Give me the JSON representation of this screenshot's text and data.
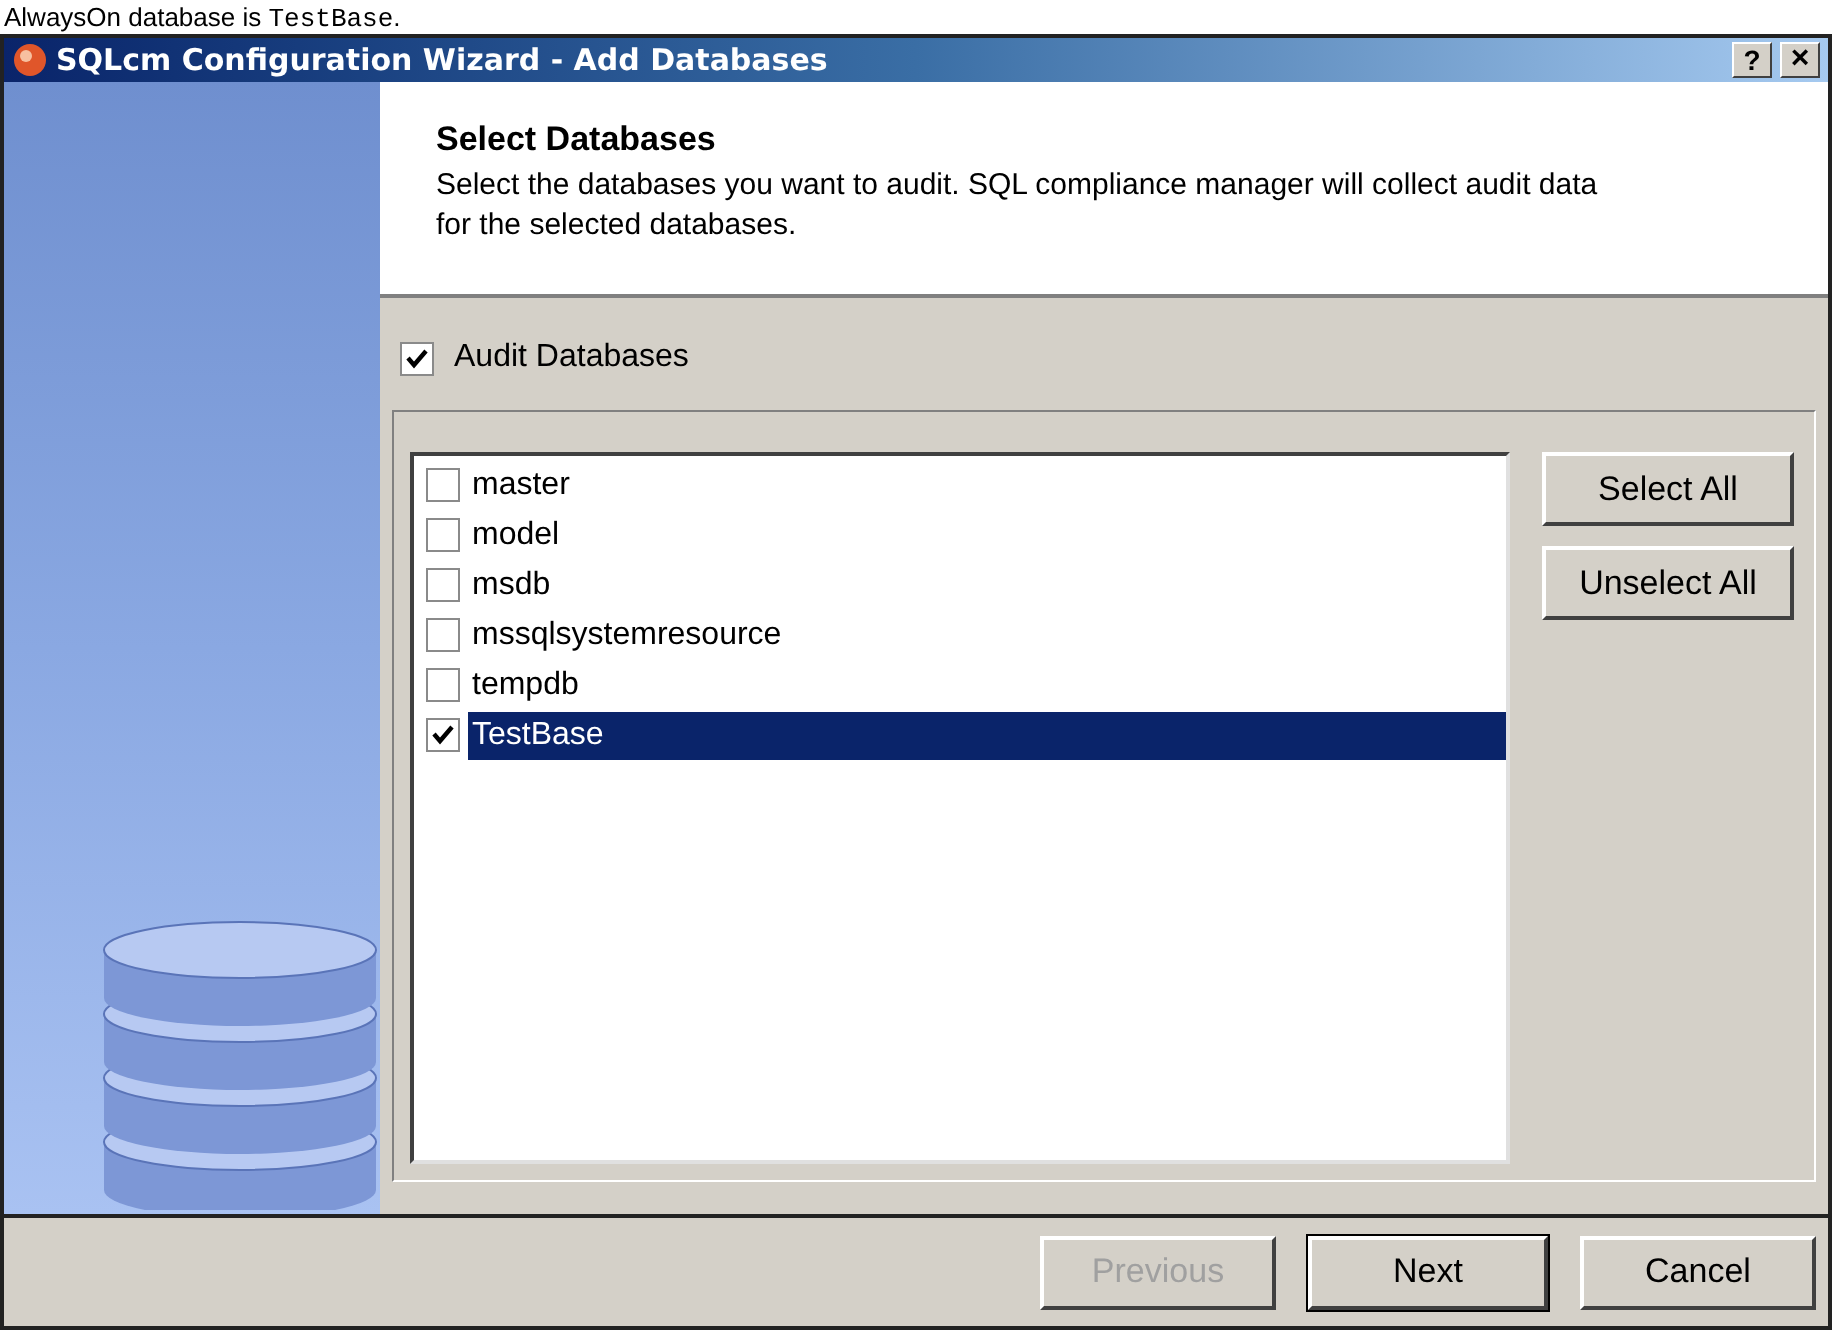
{
  "caption": {
    "text": "AlwaysOn database is ",
    "code": "TestBase",
    "end": "."
  },
  "window": {
    "title": "SQLcm Configuration Wizard - Add Databases",
    "help": "?",
    "close": "×"
  },
  "header": {
    "title": "Select Databases",
    "description": "Select the databases you want to audit.  SQL compliance manager will collect audit data for the selected databases."
  },
  "audit_checkbox": {
    "label": "Audit Databases",
    "checked": true
  },
  "databases": [
    {
      "name": "master",
      "checked": false,
      "selected": false
    },
    {
      "name": "model",
      "checked": false,
      "selected": false
    },
    {
      "name": "msdb",
      "checked": false,
      "selected": false
    },
    {
      "name": "mssqlsystemresource",
      "checked": false,
      "selected": false
    },
    {
      "name": "tempdb",
      "checked": false,
      "selected": false
    },
    {
      "name": "TestBase",
      "checked": true,
      "selected": true
    }
  ],
  "side_buttons": [
    "Select All",
    "Unselect All"
  ],
  "footer_buttons": [
    {
      "label": "Previous",
      "disabled": true,
      "default": false
    },
    {
      "label": "Next",
      "disabled": false,
      "default": true
    },
    {
      "label": "Cancel",
      "disabled": false,
      "default": false
    }
  ]
}
